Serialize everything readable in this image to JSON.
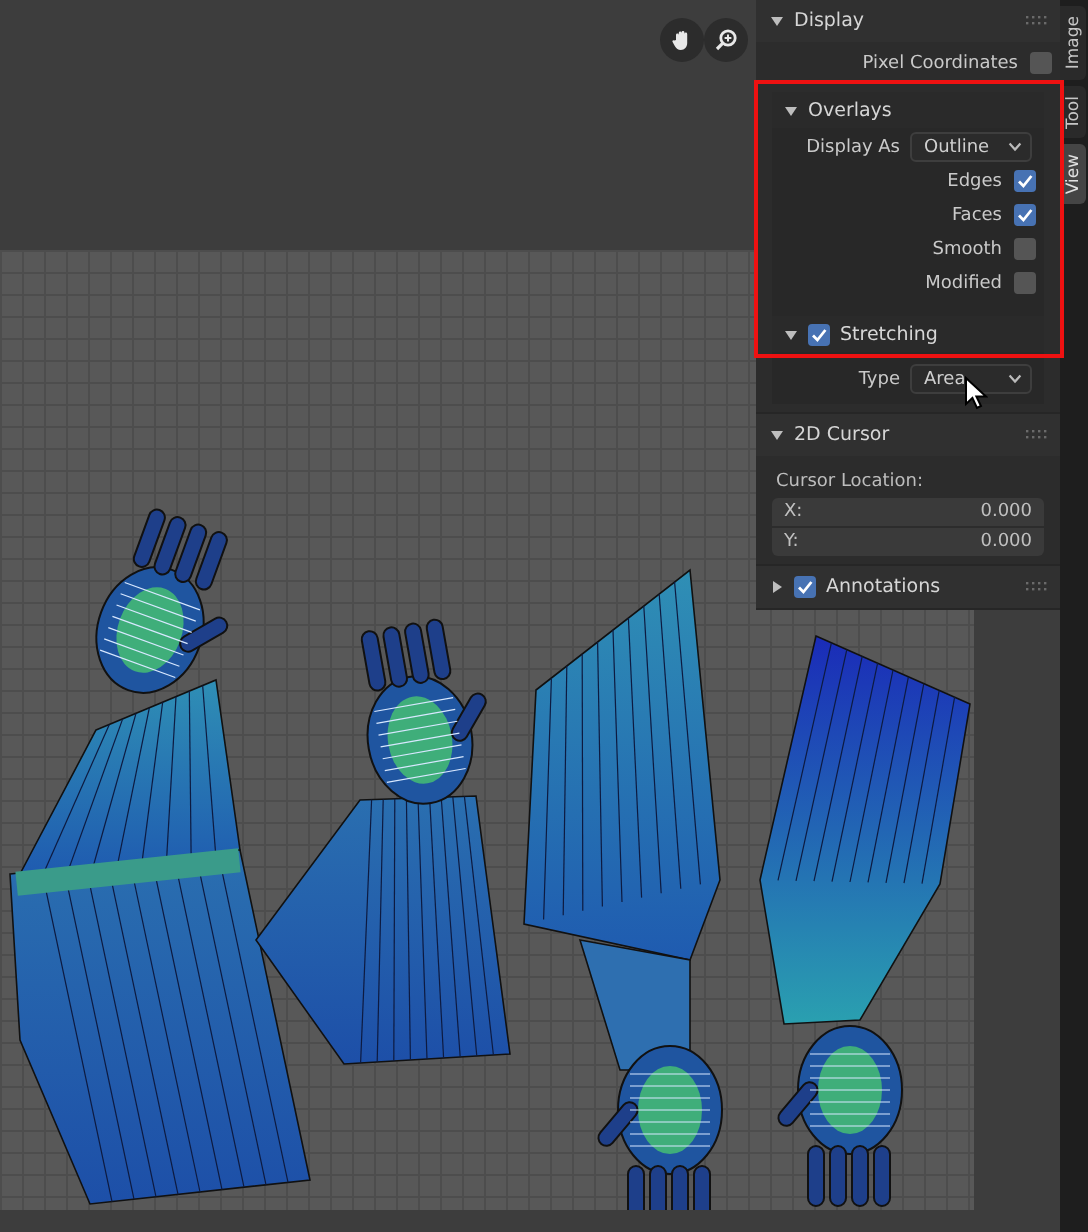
{
  "sidebar": {
    "tabs": [
      {
        "label": "Image",
        "selected": false
      },
      {
        "label": "Tool",
        "selected": false
      },
      {
        "label": "View",
        "selected": true
      }
    ],
    "panels": [
      {
        "title": "Display",
        "expanded": true,
        "rows": [
          {
            "kind": "checkbox",
            "label": "Pixel Coordinates",
            "checked": false
          },
          {
            "kind": "subpanel",
            "title": "Overlays",
            "expanded": true,
            "highlighted": true,
            "rows": [
              {
                "kind": "dropdown",
                "label": "Display As",
                "value": "Outline"
              },
              {
                "kind": "checkbox",
                "label": "Edges",
                "checked": true
              },
              {
                "kind": "checkbox",
                "label": "Faces",
                "checked": true
              },
              {
                "kind": "checkbox",
                "label": "Smooth",
                "checked": false
              },
              {
                "kind": "checkbox",
                "label": "Modified",
                "checked": false
              },
              {
                "kind": "subpanel",
                "title": "Stretching",
                "expanded": true,
                "checked": true,
                "rows": [
                  {
                    "kind": "dropdown",
                    "label": "Type",
                    "value": "Area"
                  }
                ]
              }
            ]
          }
        ]
      },
      {
        "title": "2D Cursor",
        "expanded": true,
        "rows": [
          {
            "kind": "caption",
            "label": "Cursor Location:"
          },
          {
            "kind": "number",
            "label": "X:",
            "value": "0.000"
          },
          {
            "kind": "number",
            "label": "Y:",
            "value": "0.000"
          }
        ]
      },
      {
        "title": "Annotations",
        "expanded": false,
        "checked": true
      }
    ]
  }
}
